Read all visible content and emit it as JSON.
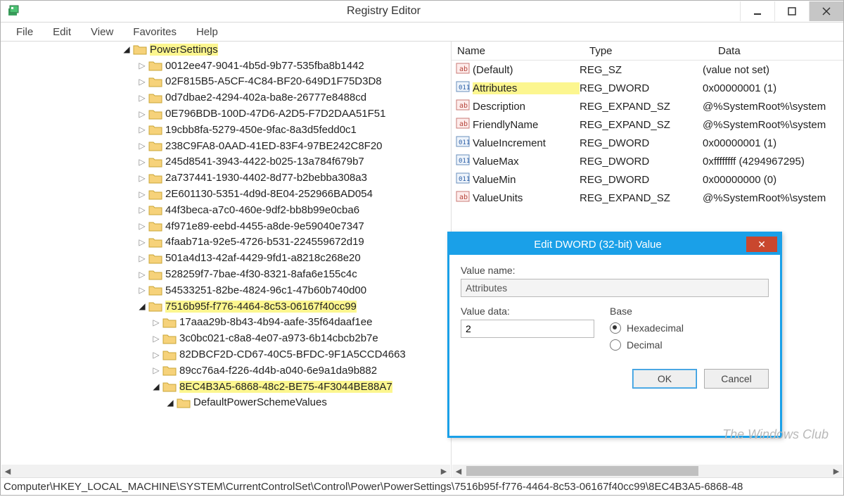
{
  "window": {
    "title": "Registry Editor"
  },
  "menu": {
    "file": "File",
    "edit": "Edit",
    "view": "View",
    "favorites": "Favorites",
    "help": "Help"
  },
  "tree": {
    "root": "PowerSettings",
    "guids": [
      "0012ee47-9041-4b5d-9b77-535fba8b1442",
      "02F815B5-A5CF-4C84-BF20-649D1F75D3D8",
      "0d7dbae2-4294-402a-ba8e-26777e8488cd",
      "0E796BDB-100D-47D6-A2D5-F7D2DAA51F51",
      "19cbb8fa-5279-450e-9fac-8a3d5fedd0c1",
      "238C9FA8-0AAD-41ED-83F4-97BE242C8F20",
      "245d8541-3943-4422-b025-13a784f679b7",
      "2a737441-1930-4402-8d77-b2bebba308a3",
      "2E601130-5351-4d9d-8E04-252966BAD054",
      "44f3beca-a7c0-460e-9df2-bb8b99e0cba6",
      "4f971e89-eebd-4455-a8de-9e59040e7347",
      "4faab71a-92e5-4726-b531-224559672d19",
      "501a4d13-42af-4429-9fd1-a8218c268e20",
      "528259f7-7bae-4f30-8321-8afa6e155c4c",
      "54533251-82be-4824-96c1-47b60b740d00"
    ],
    "selected_guid": "7516b95f-f776-4464-8c53-06167f40cc99",
    "sub_guids": [
      "17aaa29b-8b43-4b94-aafe-35f64daaf1ee",
      "3c0bc021-c8a8-4e07-a973-6b14cbcb2b7e",
      "82DBCF2D-CD67-40C5-BFDC-9F1A5CCD4663",
      "89cc76a4-f226-4d4b-a040-6e9a1da9b882"
    ],
    "selected_sub_guid": "8EC4B3A5-6868-48c2-BE75-4F3044BE88A7",
    "leaf": "DefaultPowerSchemeValues"
  },
  "list": {
    "cols": {
      "name": "Name",
      "type": "Type",
      "data": "Data"
    },
    "rows": [
      {
        "icon": "sz",
        "name": "(Default)",
        "type": "REG_SZ",
        "data": "(value not set)",
        "hl": false
      },
      {
        "icon": "dw",
        "name": "Attributes",
        "type": "REG_DWORD",
        "data": "0x00000001 (1)",
        "hl": true
      },
      {
        "icon": "sz",
        "name": "Description",
        "type": "REG_EXPAND_SZ",
        "data": "@%SystemRoot%\\system",
        "hl": false
      },
      {
        "icon": "sz",
        "name": "FriendlyName",
        "type": "REG_EXPAND_SZ",
        "data": "@%SystemRoot%\\system",
        "hl": false
      },
      {
        "icon": "dw",
        "name": "ValueIncrement",
        "type": "REG_DWORD",
        "data": "0x00000001 (1)",
        "hl": false
      },
      {
        "icon": "dw",
        "name": "ValueMax",
        "type": "REG_DWORD",
        "data": "0xffffffff (4294967295)",
        "hl": false
      },
      {
        "icon": "dw",
        "name": "ValueMin",
        "type": "REG_DWORD",
        "data": "0x00000000 (0)",
        "hl": false
      },
      {
        "icon": "sz",
        "name": "ValueUnits",
        "type": "REG_EXPAND_SZ",
        "data": "@%SystemRoot%\\system",
        "hl": false
      }
    ]
  },
  "dialog": {
    "title": "Edit DWORD (32-bit) Value",
    "valuename_label": "Value name:",
    "valuename": "Attributes",
    "valuedata_label": "Value data:",
    "valuedata": "2",
    "base_label": "Base",
    "hex": "Hexadecimal",
    "dec": "Decimal",
    "ok": "OK",
    "cancel": "Cancel"
  },
  "status": "Computer\\HKEY_LOCAL_MACHINE\\SYSTEM\\CurrentControlSet\\Control\\Power\\PowerSettings\\7516b95f-f776-4464-8c53-06167f40cc99\\8EC4B3A5-6868-48",
  "watermark": "The\nWindows Club"
}
